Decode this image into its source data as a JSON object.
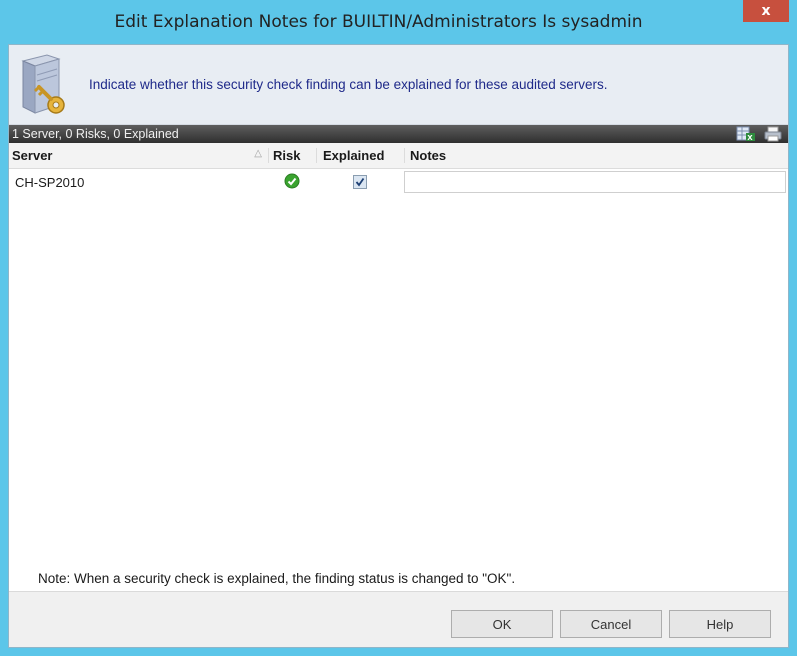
{
  "window": {
    "title": "Edit Explanation Notes for BUILTIN/Administrators Is sysadmin",
    "close_label": "x"
  },
  "banner": {
    "text": "Indicate whether this security check finding can be explained for these audited servers."
  },
  "grid": {
    "summary": "1 Server, 0 Risks, 0 Explained",
    "columns": {
      "server": "Server",
      "risk": "Risk",
      "explained": "Explained",
      "notes": "Notes"
    },
    "rows": [
      {
        "server": "CH-SP2010",
        "risk": "ok",
        "explained": true,
        "notes": ""
      }
    ]
  },
  "note": "Note: When a security check is explained, the finding status is changed to \"OK\".",
  "buttons": {
    "ok": "OK",
    "cancel": "Cancel",
    "help": "Help"
  },
  "colors": {
    "frame": "#5cc6e9",
    "close": "#c7503e",
    "banner_text": "#1f2a8a",
    "ok_icon": "#3aa32f"
  },
  "icons": {
    "banner": "server-key-icon",
    "export": "excel-export-icon",
    "print": "print-icon",
    "risk_ok": "check-circle-icon"
  }
}
